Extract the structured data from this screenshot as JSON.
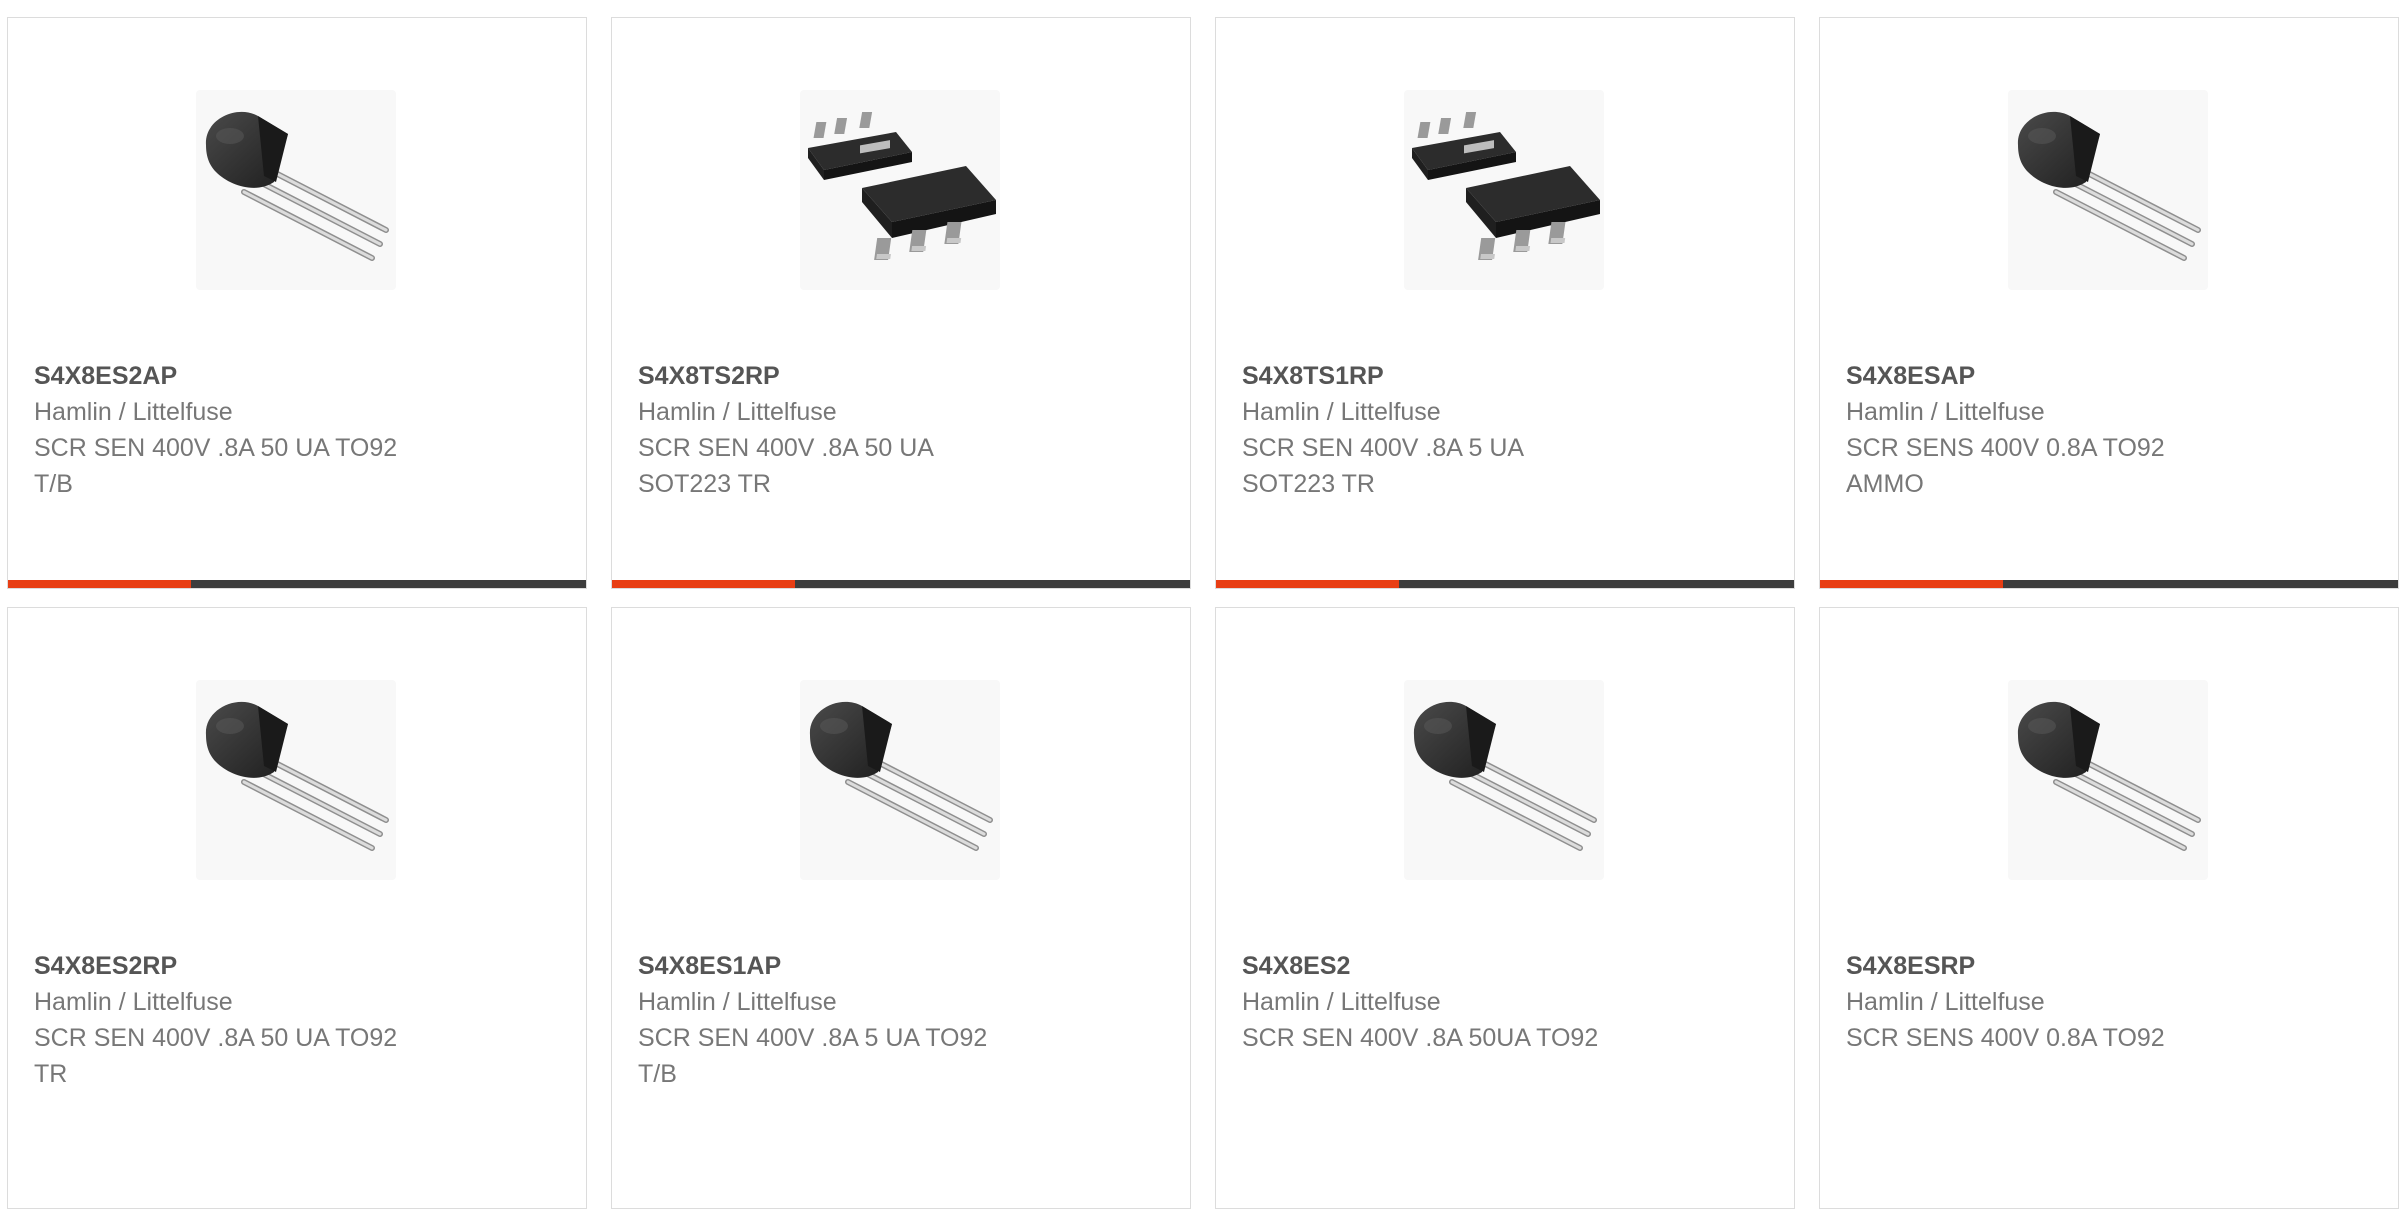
{
  "colors": {
    "accent": "#e83e14",
    "bar_dark": "#3d3d3d",
    "title_text": "#555555",
    "body_text": "#777777",
    "border": "#dcdcdc"
  },
  "products": [
    {
      "part": "S4X8ES2AP",
      "manufacturer": "Hamlin / Littelfuse",
      "desc1": "SCR SEN 400V .8A 50 UA TO92",
      "desc2": "T/B",
      "image": "to92-transistor-icon",
      "image_label": "S4X8ES2AP"
    },
    {
      "part": "S4X8TS2RP",
      "manufacturer": "Hamlin / Littelfuse",
      "desc1": "SCR SEN 400V .8A 50 UA",
      "desc2": "SOT223 TR",
      "image": "sot223-package-icon",
      "image_label": "S4X8TS2RP"
    },
    {
      "part": "S4X8TS1RP",
      "manufacturer": "Hamlin / Littelfuse",
      "desc1": "SCR SEN 400V .8A 5 UA",
      "desc2": "SOT223 TR",
      "image": "sot223-package-icon",
      "image_label": "S4X8TS1RP"
    },
    {
      "part": "S4X8ESAP",
      "manufacturer": "Hamlin / Littelfuse",
      "desc1": "SCR SENS 400V 0.8A TO92",
      "desc2": "AMMO",
      "image": "to92-transistor-icon",
      "image_label": "S4X8ESAP"
    },
    {
      "part": "S4X8ES2RP",
      "manufacturer": "Hamlin / Littelfuse",
      "desc1": "SCR SEN 400V .8A 50 UA TO92",
      "desc2": "TR",
      "image": "to92-transistor-icon",
      "image_label": "S4X8ES2RP"
    },
    {
      "part": "S4X8ES1AP",
      "manufacturer": "Hamlin / Littelfuse",
      "desc1": "SCR SEN 400V .8A 5 UA TO92",
      "desc2": "T/B",
      "image": "to92-transistor-icon",
      "image_label": "S4X8ES1AP"
    },
    {
      "part": "S4X8ES2",
      "manufacturer": "Hamlin / Littelfuse",
      "desc1": "SCR SEN 400V .8A 50UA TO92",
      "desc2": "",
      "image": "to92-transistor-icon",
      "image_label": "S4X8ES2"
    },
    {
      "part": "S4X8ESRP",
      "manufacturer": "Hamlin / Littelfuse",
      "desc1": "SCR SENS 400V 0.8A TO92",
      "desc2": "",
      "image": "to92-transistor-icon",
      "image_label": "S4X8ESRP"
    }
  ]
}
